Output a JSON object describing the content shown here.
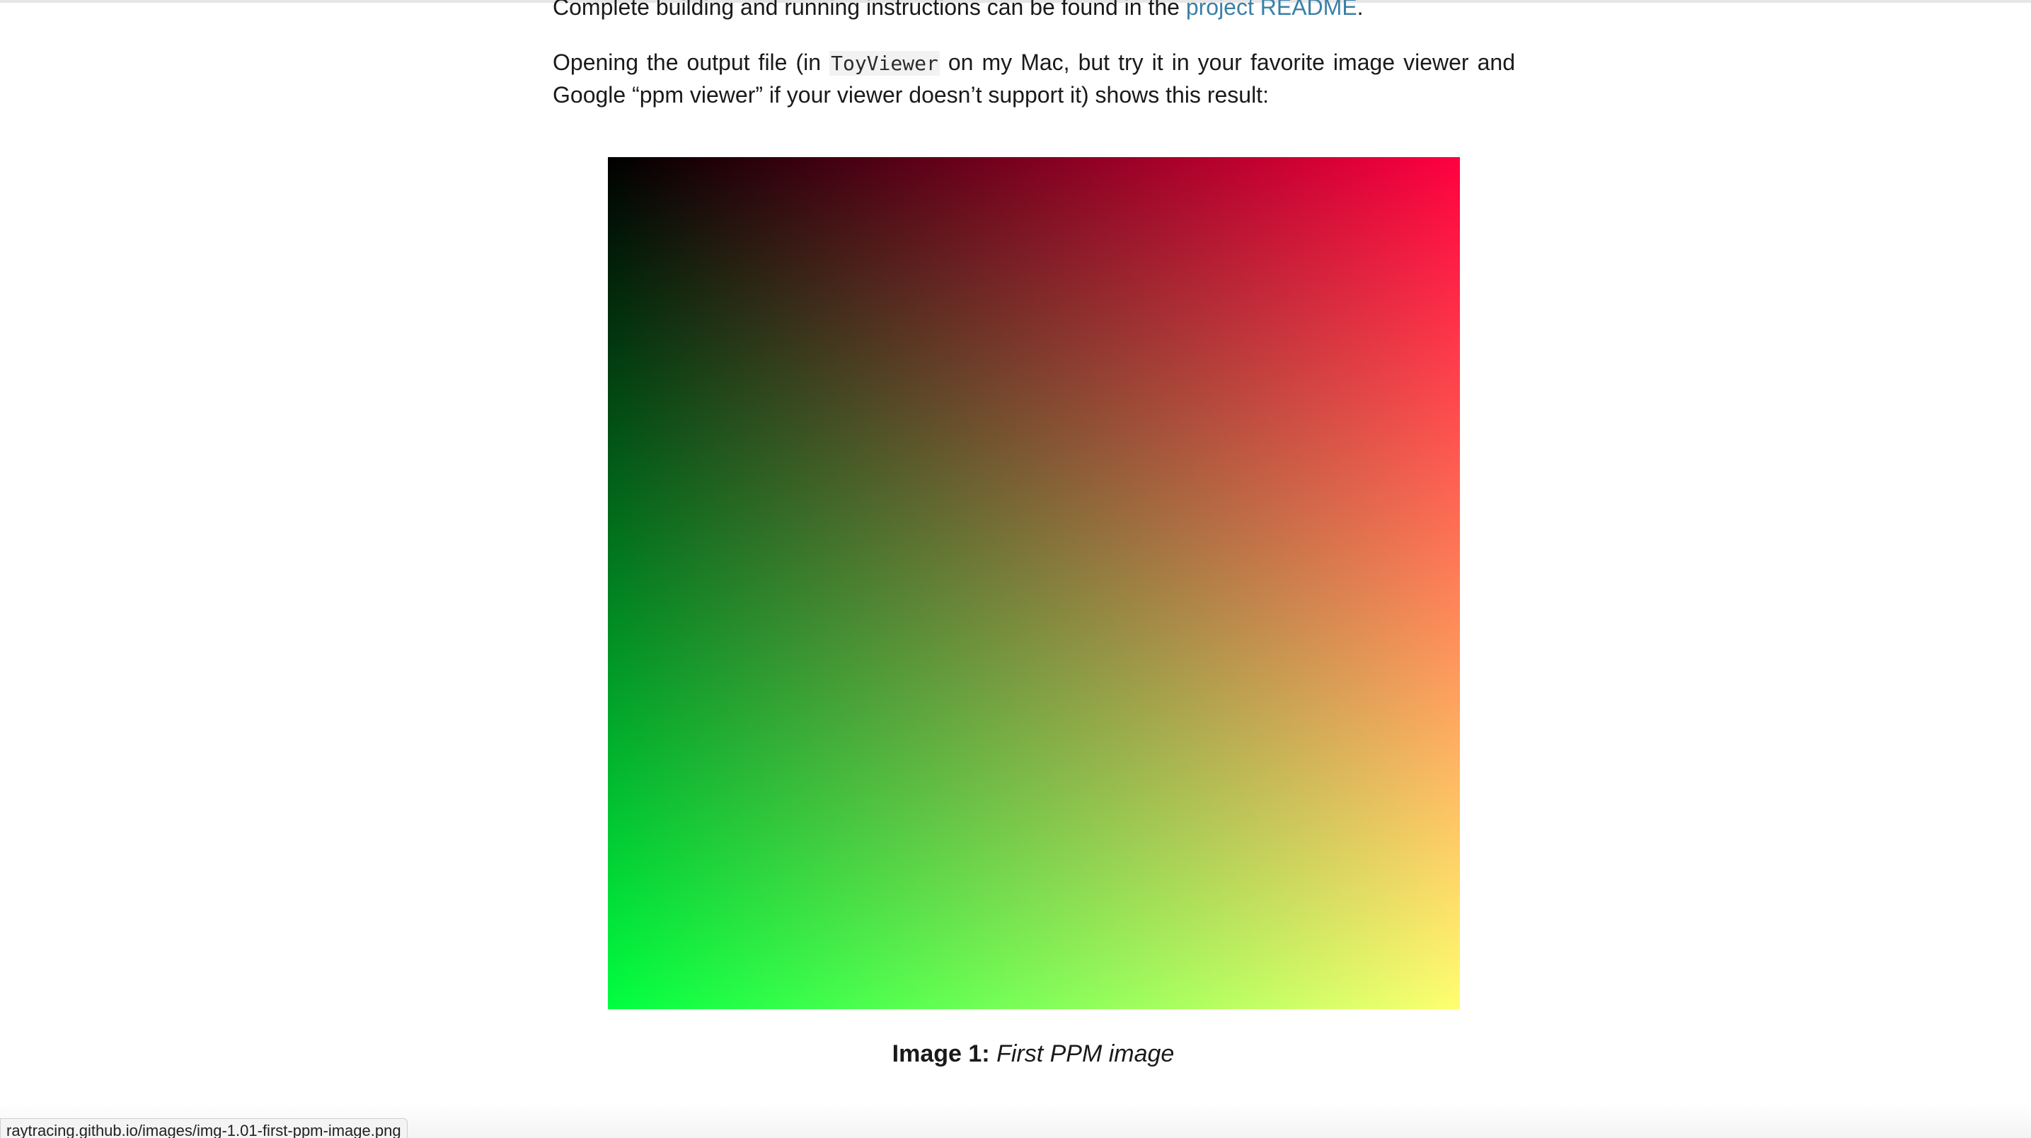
{
  "article": {
    "para1": {
      "text_before_link": "Complete building and running instructions can be found in the ",
      "link_text": "project README",
      "text_after_link": "."
    },
    "para2": {
      "line1_part1": "Opening the output file (in ",
      "code": "ToyViewer",
      "line1_part2": " on my Mac, but try it in your favorite image viewer and",
      "line2": "Google “ppm viewer” if your viewer doesn’t support it) shows this result:"
    }
  },
  "figure": {
    "caption_label": "Image 1:",
    "caption_text": "First PPM image",
    "colors": {
      "top_left": "#000000",
      "top_right": "#ff0040",
      "bottom_left": "#00ff40",
      "bottom_right": "#ffff40"
    }
  },
  "status_bar": {
    "url": "raytracing.github.io/images/img-1.01-first-ppm-image.png"
  },
  "colors": {
    "link": "#3a7fa8",
    "text": "#1a1a1a"
  }
}
